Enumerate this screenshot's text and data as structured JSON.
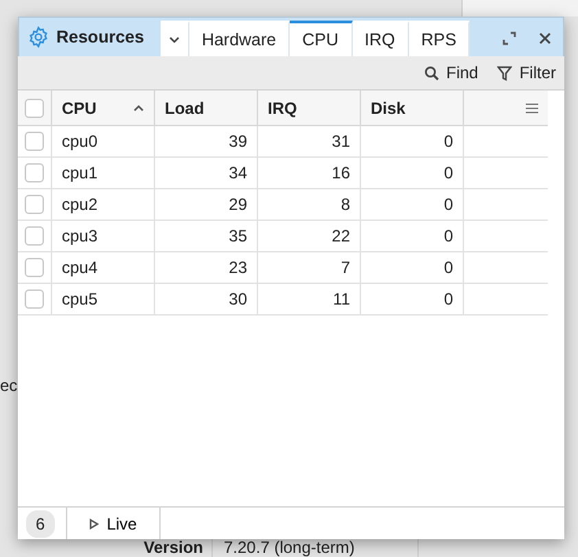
{
  "background": {
    "side_label": "ec",
    "field_label": "Version",
    "field_value": "7.20.7 (long-term)"
  },
  "window": {
    "title": "Resources",
    "tabs": [
      {
        "label": "Hardware",
        "selected": false
      },
      {
        "label": "CPU",
        "selected": true
      },
      {
        "label": "IRQ",
        "selected": false
      },
      {
        "label": "RPS",
        "selected": false
      }
    ]
  },
  "toolbar": {
    "actions": [
      {
        "kind": "find",
        "label": "Find"
      },
      {
        "kind": "filter",
        "label": "Filter"
      }
    ]
  },
  "table": {
    "all_checked": false,
    "columns": [
      {
        "label": "CPU",
        "sorted": true
      },
      {
        "label": "Load",
        "sorted": false
      },
      {
        "label": "IRQ",
        "sorted": false
      },
      {
        "label": "Disk",
        "sorted": false
      }
    ],
    "rows": [
      {
        "checked": false,
        "cells": [
          "cpu0",
          "39",
          "31",
          "0"
        ]
      },
      {
        "checked": false,
        "cells": [
          "cpu1",
          "34",
          "16",
          "0"
        ]
      },
      {
        "checked": false,
        "cells": [
          "cpu2",
          "29",
          "8",
          "0"
        ]
      },
      {
        "checked": false,
        "cells": [
          "cpu3",
          "35",
          "22",
          "0"
        ]
      },
      {
        "checked": false,
        "cells": [
          "cpu4",
          "23",
          "7",
          "0"
        ]
      },
      {
        "checked": false,
        "cells": [
          "cpu5",
          "30",
          "11",
          "0"
        ]
      }
    ]
  },
  "status_bar": {
    "count": "6",
    "live_label": "Live"
  }
}
